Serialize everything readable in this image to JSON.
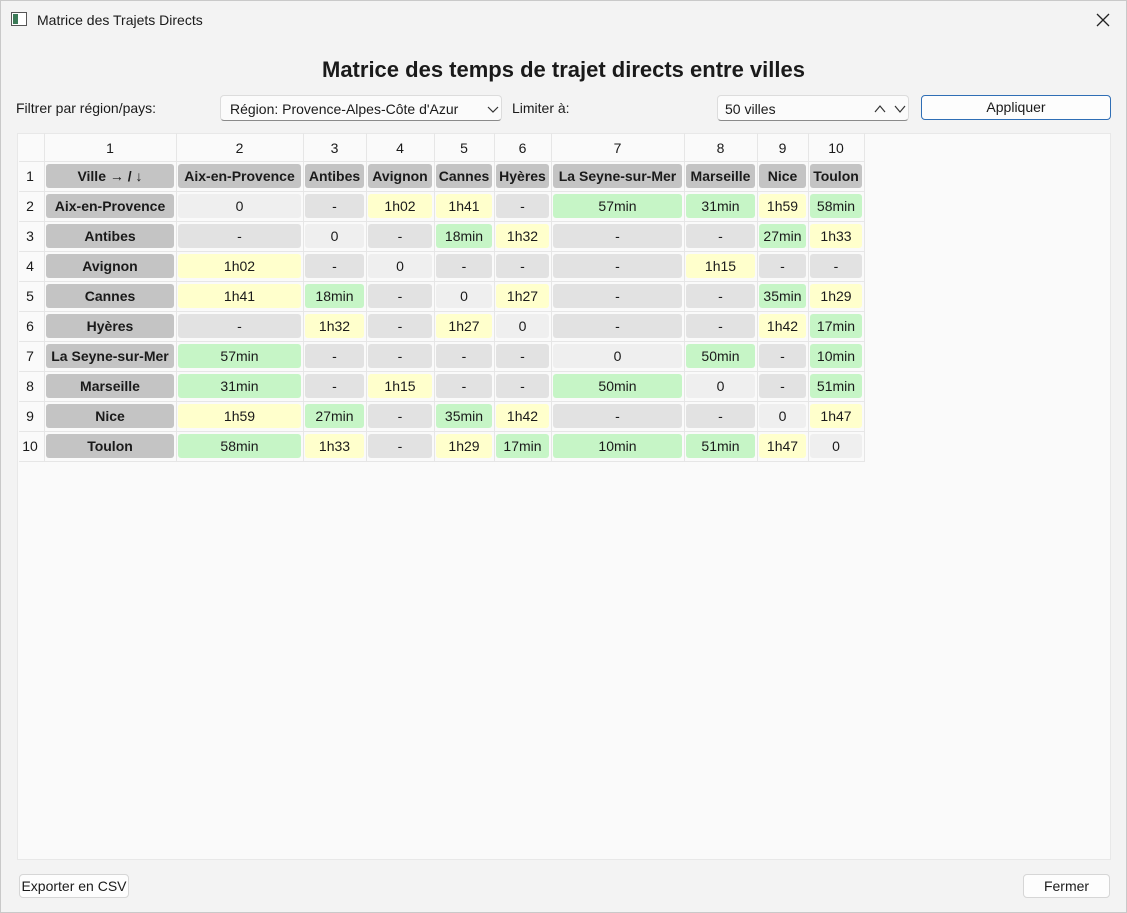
{
  "window": {
    "title": "Matrice des Trajets Directs"
  },
  "heading": "Matrice des temps de trajet directs entre villes",
  "filter": {
    "label": "Filtrer par région/pays:",
    "region_value": "Région: Provence-Alpes-Côte d'Azur",
    "limit_label": "Limiter à:",
    "limit_value": "50 villes",
    "apply_label": "Appliquer"
  },
  "table": {
    "col_numbers": [
      "1",
      "2",
      "3",
      "4",
      "5",
      "6",
      "7",
      "8",
      "9",
      "10"
    ],
    "row_numbers": [
      "1",
      "2",
      "3",
      "4",
      "5",
      "6",
      "7",
      "8",
      "9",
      "10"
    ],
    "corner": "Ville → / ↓",
    "cities": [
      "Aix-en-Provence",
      "Antibes",
      "Avignon",
      "Cannes",
      "Hyères",
      "La Seyne-sur-Mer",
      "Marseille",
      "Nice",
      "Toulon"
    ],
    "rows": [
      [
        "0",
        "-",
        "1h02",
        "1h41",
        "-",
        "57min",
        "31min",
        "1h59",
        "58min"
      ],
      [
        "-",
        "0",
        "-",
        "18min",
        "1h32",
        "-",
        "-",
        "27min",
        "1h33"
      ],
      [
        "1h02",
        "-",
        "0",
        "-",
        "-",
        "-",
        "1h15",
        "-",
        "-"
      ],
      [
        "1h41",
        "18min",
        "-",
        "0",
        "1h27",
        "-",
        "-",
        "35min",
        "1h29"
      ],
      [
        "-",
        "1h32",
        "-",
        "1h27",
        "0",
        "-",
        "-",
        "1h42",
        "17min"
      ],
      [
        "57min",
        "-",
        "-",
        "-",
        "-",
        "0",
        "50min",
        "-",
        "10min"
      ],
      [
        "31min",
        "-",
        "1h15",
        "-",
        "-",
        "50min",
        "0",
        "-",
        "51min"
      ],
      [
        "1h59",
        "27min",
        "-",
        "35min",
        "1h42",
        "-",
        "-",
        "0",
        "1h47"
      ],
      [
        "58min",
        "1h33",
        "-",
        "1h29",
        "17min",
        "10min",
        "51min",
        "1h47",
        "0"
      ]
    ]
  },
  "colors": {
    "short": "#c6f5c6",
    "long": "#ffffcc",
    "none": "#e2e2e2",
    "self": "#efefef",
    "header": "#c4c4c4",
    "accent": "#2f6eb5"
  },
  "footer": {
    "export_label": "Exporter en CSV",
    "close_label": "Fermer"
  },
  "icons": [
    "app-icon",
    "close-icon",
    "chevron-down-icon",
    "chevron-up-icon"
  ]
}
